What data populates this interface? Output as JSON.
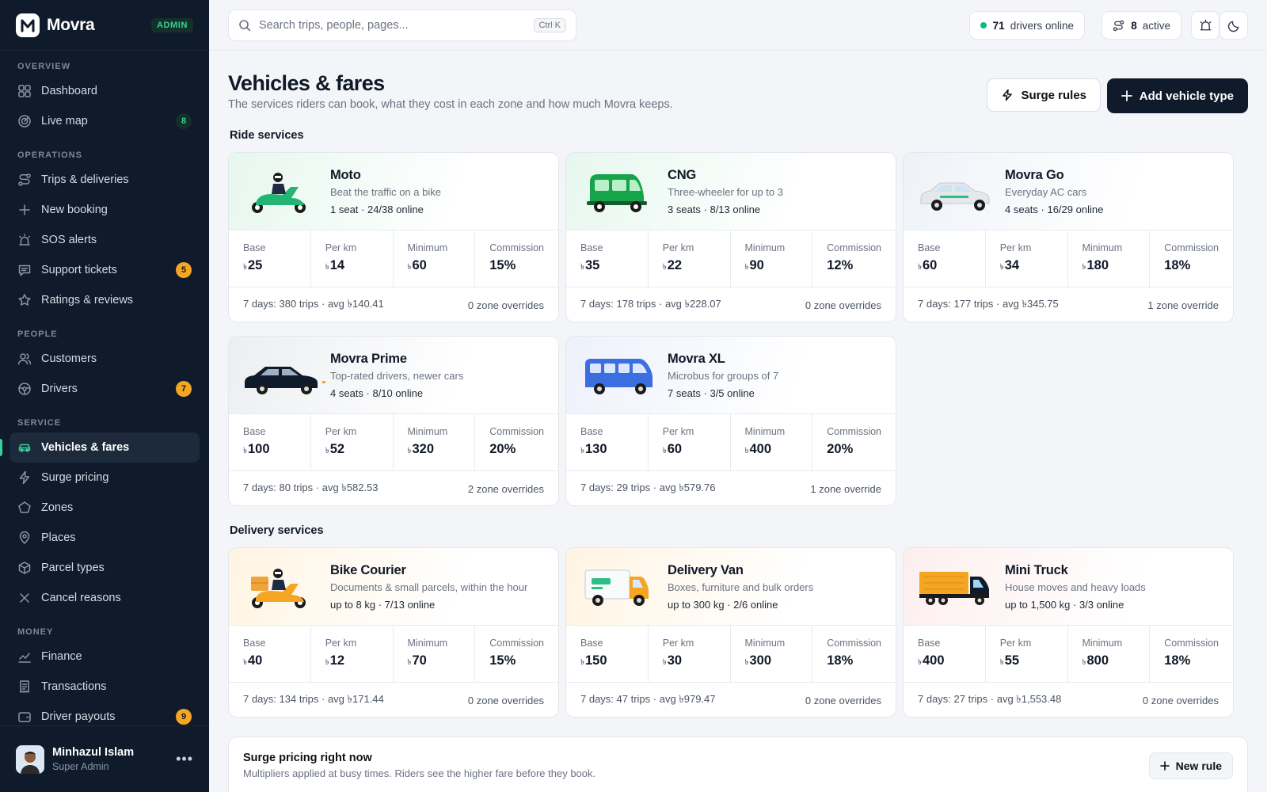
{
  "brand": {
    "name": "Movra",
    "badge": "ADMIN"
  },
  "nav": {
    "sections": [
      {
        "label": "OVERVIEW",
        "items": [
          {
            "label": "Dashboard",
            "icon": "grid-icon"
          },
          {
            "label": "Live map",
            "icon": "radar-icon",
            "badge": "8",
            "badge_color": "green"
          }
        ]
      },
      {
        "label": "OPERATIONS",
        "items": [
          {
            "label": "Trips & deliveries",
            "icon": "route-icon"
          },
          {
            "label": "New booking",
            "icon": "plus-icon"
          },
          {
            "label": "SOS alerts",
            "icon": "siren-icon"
          },
          {
            "label": "Support tickets",
            "icon": "message-icon",
            "badge": "5",
            "badge_color": "amber"
          },
          {
            "label": "Ratings & reviews",
            "icon": "star-icon"
          }
        ]
      },
      {
        "label": "PEOPLE",
        "items": [
          {
            "label": "Customers",
            "icon": "users-icon"
          },
          {
            "label": "Drivers",
            "icon": "steering-wheel-icon",
            "badge": "7",
            "badge_color": "amber"
          }
        ]
      },
      {
        "label": "SERVICE",
        "items": [
          {
            "label": "Vehicles & fares",
            "icon": "car-icon",
            "active": true
          },
          {
            "label": "Surge pricing",
            "icon": "bolt-icon"
          },
          {
            "label": "Zones",
            "icon": "pentagon-icon"
          },
          {
            "label": "Places",
            "icon": "map-pin-icon"
          },
          {
            "label": "Parcel types",
            "icon": "package-icon"
          },
          {
            "label": "Cancel reasons",
            "icon": "x-icon"
          }
        ]
      },
      {
        "label": "MONEY",
        "items": [
          {
            "label": "Finance",
            "icon": "chart-icon"
          },
          {
            "label": "Transactions",
            "icon": "receipt-icon"
          },
          {
            "label": "Driver payouts",
            "icon": "wallet-icon",
            "badge": "9",
            "badge_color": "amber"
          }
        ]
      }
    ]
  },
  "user": {
    "name": "Minhazul Islam",
    "role": "Super Admin"
  },
  "topbar": {
    "search_placeholder": "Search trips, people, pages...",
    "search_shortcut": "Ctrl K",
    "drivers_online_count": "71",
    "drivers_online_label": "drivers online",
    "active_count": "8",
    "active_label": "active"
  },
  "page": {
    "title": "Vehicles & fares",
    "subtitle": "The services riders can book, what they cost in each zone and how much Movra keeps.",
    "surge_button": "Surge rules",
    "add_button": "Add vehicle type"
  },
  "labels": {
    "base": "Base",
    "per_km": "Per km",
    "minimum": "Minimum",
    "commission": "Commission",
    "currency": "৳"
  },
  "sections": {
    "ride": "Ride services",
    "delivery": "Delivery services"
  },
  "ride_services": [
    {
      "name": "Moto",
      "desc": "Beat the traffic on a bike",
      "capacity": "1 seat · 24/38 online",
      "base": "25",
      "per_km": "14",
      "minimum": "60",
      "commission": "15%",
      "stats": "7 days: 380 trips · avg ৳140.41",
      "overrides": "0 zone overrides",
      "icon": "motorbike-icon",
      "color": "#22b573"
    },
    {
      "name": "CNG",
      "desc": "Three-wheeler for up to 3",
      "capacity": "3 seats · 8/13 online",
      "base": "35",
      "per_km": "22",
      "minimum": "90",
      "commission": "12%",
      "stats": "7 days: 178 trips · avg ৳228.07",
      "overrides": "0 zone overrides",
      "icon": "cng-icon",
      "color": "#16a34a"
    },
    {
      "name": "Movra Go",
      "desc": "Everyday AC cars",
      "capacity": "4 seats · 16/29 online",
      "base": "60",
      "per_km": "34",
      "minimum": "180",
      "commission": "18%",
      "stats": "7 days: 177 trips · avg ৳345.75",
      "overrides": "1 zone override",
      "icon": "car-icon",
      "color": "#e5e7eb"
    },
    {
      "name": "Movra Prime",
      "desc": "Top-rated drivers, newer cars",
      "capacity": "4 seats · 8/10 online",
      "base": "100",
      "per_km": "52",
      "minimum": "320",
      "commission": "20%",
      "stats": "7 days: 80 trips · avg ৳582.53",
      "overrides": "2 zone overrides",
      "icon": "sedan-icon",
      "color": "#0f1a2a"
    },
    {
      "name": "Movra XL",
      "desc": "Microbus for groups of 7",
      "capacity": "7 seats · 3/5 online",
      "base": "130",
      "per_km": "60",
      "minimum": "400",
      "commission": "20%",
      "stats": "7 days: 29 trips · avg ৳579.76",
      "overrides": "1 zone override",
      "icon": "microbus-icon",
      "color": "#3b6fe0"
    }
  ],
  "delivery_services": [
    {
      "name": "Bike Courier",
      "desc": "Documents & small parcels, within the hour",
      "capacity": "up to 8 kg · 7/13 online",
      "base": "40",
      "per_km": "12",
      "minimum": "70",
      "commission": "15%",
      "stats": "7 days: 134 trips · avg ৳171.44",
      "overrides": "0 zone overrides",
      "icon": "courier-bike-icon",
      "color": "#f5a524"
    },
    {
      "name": "Delivery Van",
      "desc": "Boxes, furniture and bulk orders",
      "capacity": "up to 300 kg · 2/6 online",
      "base": "150",
      "per_km": "30",
      "minimum": "300",
      "commission": "18%",
      "stats": "7 days: 47 trips · avg ৳979.47",
      "overrides": "0 zone overrides",
      "icon": "van-icon",
      "color": "#f5a524"
    },
    {
      "name": "Mini Truck",
      "desc": "House moves and heavy loads",
      "capacity": "up to 1,500 kg · 3/3 online",
      "base": "400",
      "per_km": "55",
      "minimum": "800",
      "commission": "18%",
      "stats": "7 days: 27 trips · avg ৳1,553.48",
      "overrides": "0 zone overrides",
      "icon": "truck-icon",
      "color": "#f5a524"
    }
  ],
  "surge_panel": {
    "title": "Surge pricing right now",
    "subtitle": "Multipliers applied at busy times. Riders see the higher fare before they book.",
    "button": "New rule"
  }
}
